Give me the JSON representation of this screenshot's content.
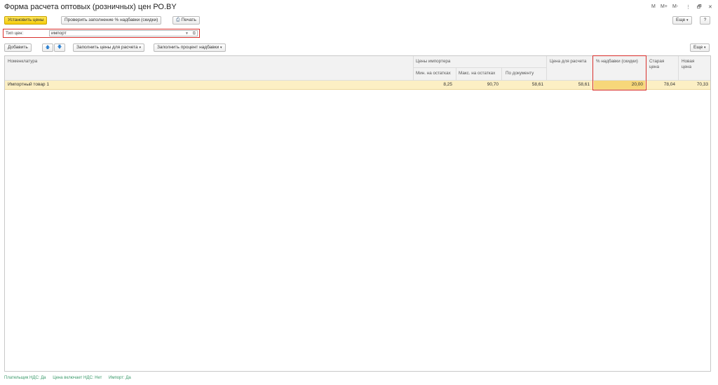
{
  "window": {
    "title": "Форма расчета оптовых (розничных) цен РО.BY",
    "controls": [
      "M",
      "M+",
      "M-",
      "⋮",
      "🗗",
      "✕"
    ]
  },
  "toolbar": {
    "set_prices": "Установить цены",
    "check_fill": "Проверить заполнение % надбавки (скидки)",
    "print": "Печать",
    "more": "Еще",
    "help": "?"
  },
  "price_type": {
    "label": "Тип цен:",
    "value": "импорт"
  },
  "table_toolbar": {
    "add": "Добавить",
    "fill_prices": "Заполнить цены для расчета",
    "fill_percent": "Заполнить процент надбавки",
    "more": "Еще"
  },
  "table": {
    "headers": {
      "nomenclature": "Номенклатура",
      "importer_prices": "Цены импортера",
      "min_stock": "Мин. на остатках",
      "max_stock": "Макс. на остатках",
      "by_document": "По документу",
      "calc_price": "Цена для расчета",
      "markup": "% надбавки (скидки)",
      "old_price_1": "Старая",
      "old_price_2": "цена",
      "new_price_1": "Новая",
      "new_price_2": "цена"
    },
    "rows": [
      {
        "name": "Импортный товар 1",
        "min": "8,25",
        "max": "90,70",
        "doc": "58,61",
        "calc": "58,61",
        "markup": "20,00",
        "old": "78,04",
        "new": "70,33"
      }
    ]
  },
  "footer": {
    "vat_payer": "Плательщик НДС: Да",
    "price_incl_vat": "Цена включает НДС: Нет",
    "import": "Импорт: Да"
  },
  "colors": {
    "primary_button": "#f5cc0a",
    "highlight_border": "#d9302c",
    "selected_row": "#fcefc4",
    "footer_text": "#3a9a6a"
  }
}
